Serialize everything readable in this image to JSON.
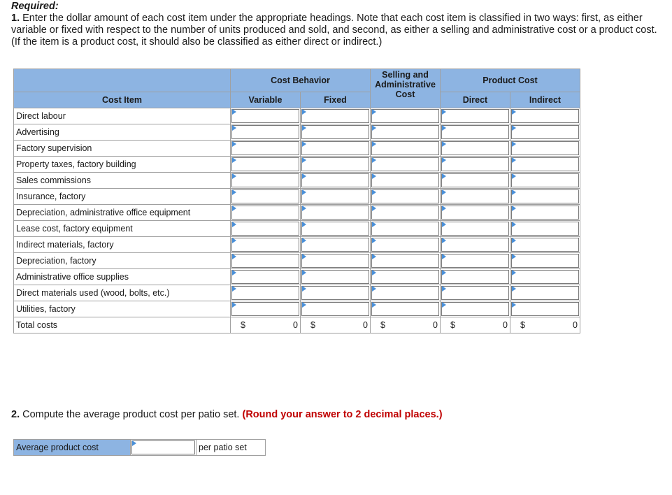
{
  "instructions": {
    "required_label": "Required:",
    "part1_number": "1.",
    "part1_text": " Enter the dollar amount of each cost item under the appropriate headings. Note that each cost item is classified in two ways: first, as either variable or fixed with respect to the number of units produced and sold, and second, as either a selling and administrative cost or a product cost. (If the item is a product cost, it should also be classified as either direct or indirect.)"
  },
  "table": {
    "headers": {
      "cost_item": "Cost Item",
      "cost_behavior": "Cost Behavior",
      "variable": "Variable",
      "fixed": "Fixed",
      "selling_admin_line1": "Selling and",
      "selling_admin_line2": "Administrative",
      "selling_admin_line3": "Cost",
      "product_cost": "Product Cost",
      "direct": "Direct",
      "indirect": "Indirect"
    },
    "rows": [
      {
        "label": "Direct labour"
      },
      {
        "label": "Advertising"
      },
      {
        "label": "Factory supervision"
      },
      {
        "label": "Property taxes, factory building"
      },
      {
        "label": "Sales commissions"
      },
      {
        "label": "Insurance, factory"
      },
      {
        "label": "Depreciation, administrative office equipment"
      },
      {
        "label": "Lease cost, factory equipment"
      },
      {
        "label": "Indirect materials, factory"
      },
      {
        "label": "Depreciation, factory"
      },
      {
        "label": "Administrative office supplies"
      },
      {
        "label": "Direct materials used (wood, bolts, etc.)"
      },
      {
        "label": "Utilities, factory"
      }
    ],
    "total": {
      "label": "Total costs",
      "currency": "$",
      "values": [
        "0",
        "0",
        "0",
        "0",
        "0"
      ]
    }
  },
  "part2": {
    "number": "2.",
    "text": " Compute the average product cost per patio set. ",
    "note": "(Round your answer to 2 decimal places.)",
    "label": "Average product cost",
    "value": "",
    "unit": "per patio set"
  },
  "colors": {
    "header_bg": "#8db4e2",
    "note_red": "#c00000",
    "input_marker": "#4a90d9"
  }
}
